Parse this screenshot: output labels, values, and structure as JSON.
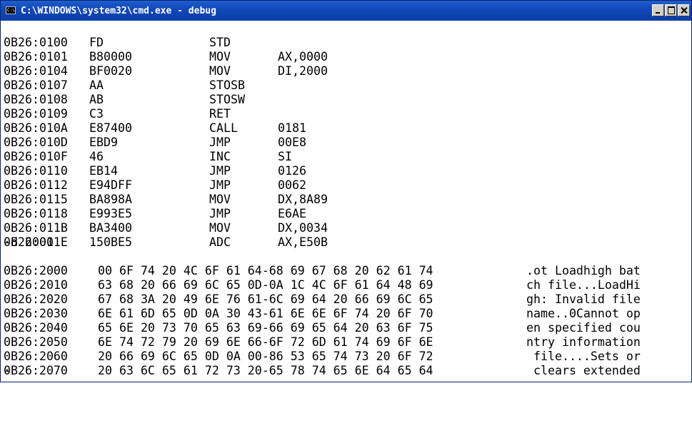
{
  "window": {
    "icon_text": "C:\\",
    "title": "C:\\WINDOWS\\system32\\cmd.exe - debug"
  },
  "disassembly": [
    {
      "addr": "0B26:0100",
      "bytes": "FD",
      "mnemonic": "STD",
      "operands": ""
    },
    {
      "addr": "0B26:0101",
      "bytes": "B80000",
      "mnemonic": "MOV",
      "operands": "AX,0000"
    },
    {
      "addr": "0B26:0104",
      "bytes": "BF0020",
      "mnemonic": "MOV",
      "operands": "DI,2000"
    },
    {
      "addr": "0B26:0107",
      "bytes": "AA",
      "mnemonic": "STOSB",
      "operands": ""
    },
    {
      "addr": "0B26:0108",
      "bytes": "AB",
      "mnemonic": "STOSW",
      "operands": ""
    },
    {
      "addr": "0B26:0109",
      "bytes": "C3",
      "mnemonic": "RET",
      "operands": ""
    },
    {
      "addr": "0B26:010A",
      "bytes": "E87400",
      "mnemonic": "CALL",
      "operands": "0181"
    },
    {
      "addr": "0B26:010D",
      "bytes": "EBD9",
      "mnemonic": "JMP",
      "operands": "00E8"
    },
    {
      "addr": "0B26:010F",
      "bytes": "46",
      "mnemonic": "INC",
      "operands": "SI"
    },
    {
      "addr": "0B26:0110",
      "bytes": "EB14",
      "mnemonic": "JMP",
      "operands": "0126"
    },
    {
      "addr": "0B26:0112",
      "bytes": "E94DFF",
      "mnemonic": "JMP",
      "operands": "0062"
    },
    {
      "addr": "0B26:0115",
      "bytes": "BA898A",
      "mnemonic": "MOV",
      "operands": "DX,8A89"
    },
    {
      "addr": "0B26:0118",
      "bytes": "E993E5",
      "mnemonic": "JMP",
      "operands": "E6AE"
    },
    {
      "addr": "0B26:011B",
      "bytes": "BA3400",
      "mnemonic": "MOV",
      "operands": "DX,0034"
    },
    {
      "addr": "0B26:011E",
      "bytes": "150BE5",
      "mnemonic": "ADC",
      "operands": "AX,E50B"
    }
  ],
  "command": "-d 2000",
  "dump": [
    {
      "addr": "0B26:2000",
      "hex": "00 6F 74 20 4C 6F 61 64-68 69 67 68 20 62 61 74",
      "ascii": ".ot Loadhigh bat"
    },
    {
      "addr": "0B26:2010",
      "hex": "63 68 20 66 69 6C 65 0D-0A 1C 4C 6F 61 64 48 69",
      "ascii": "ch file...LoadHi"
    },
    {
      "addr": "0B26:2020",
      "hex": "67 68 3A 20 49 6E 76 61-6C 69 64 20 66 69 6C 65",
      "ascii": "gh: Invalid file"
    },
    {
      "addr": "0B26:2030",
      "hex": "6E 61 6D 65 0D 0A 30 43-61 6E 6E 6F 74 20 6F 70",
      "ascii": "name..0Cannot op"
    },
    {
      "addr": "0B26:2040",
      "hex": "65 6E 20 73 70 65 63 69-66 69 65 64 20 63 6F 75",
      "ascii": "en specified cou"
    },
    {
      "addr": "0B26:2050",
      "hex": "6E 74 72 79 20 69 6E 66-6F 72 6D 61 74 69 6F 6E",
      "ascii": "ntry information"
    },
    {
      "addr": "0B26:2060",
      "hex": "20 66 69 6C 65 0D 0A 00-86 53 65 74 73 20 6F 72",
      "ascii": " file....Sets or"
    },
    {
      "addr": "0B26:2070",
      "hex": "20 63 6C 65 61 72 73 20-65 78 74 65 6E 64 65 64",
      "ascii": " clears extended"
    }
  ],
  "prompt": "-"
}
